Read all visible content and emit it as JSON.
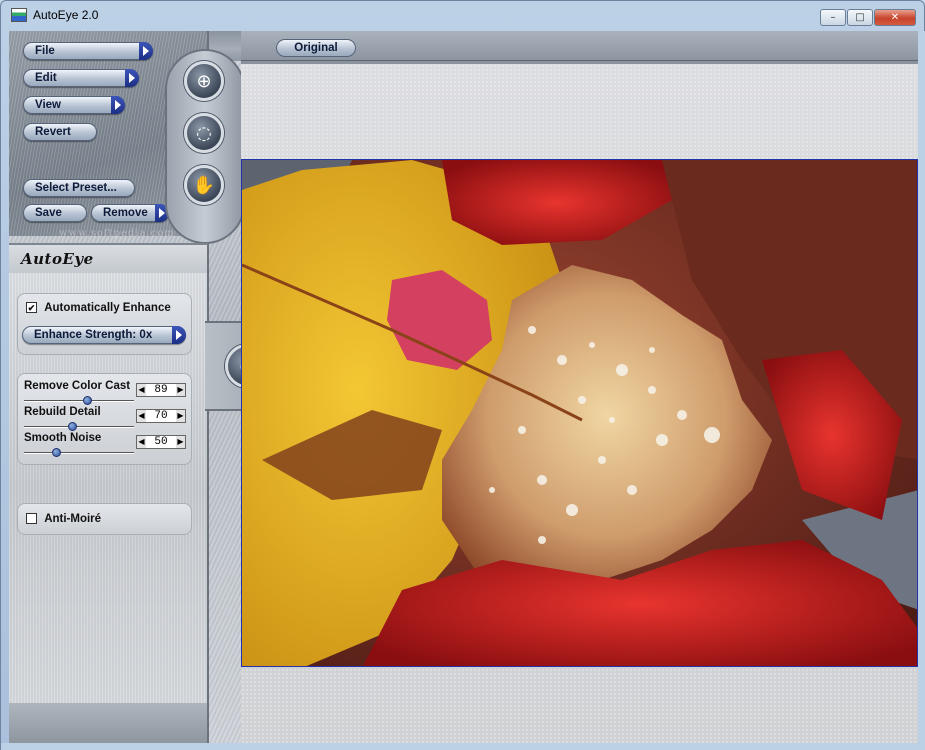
{
  "window": {
    "title": "AutoEye 2.0",
    "controls": {
      "minimize": "–",
      "maximize": "□",
      "close": "✕"
    }
  },
  "menu": {
    "file": "File",
    "edit": "Edit",
    "view": "View",
    "revert": "Revert",
    "select_preset": "Select Preset...",
    "save": "Save",
    "remove": "Remove"
  },
  "watermark": "www.softpedia.com",
  "tools": {
    "zoom_in": "zoom-in-icon",
    "navigator": "navigator-ring-icon",
    "hand": "hand-pan-icon"
  },
  "panel": {
    "title": "AutoEye",
    "tabs": [
      "eye-icon",
      "color-wheel-icon",
      "lightning-icon"
    ],
    "auto_enhance_label": "Automatically Enhance",
    "auto_enhance_checked": true,
    "enhance_strength": "Enhance Strength: 0x",
    "sliders": [
      {
        "label": "Remove Color Cast",
        "value": "89",
        "level": 0.89
      },
      {
        "label": "Rebuild Detail",
        "value": "70",
        "level": 0.7
      },
      {
        "label": "Smooth Noise",
        "value": "50",
        "level": 0.5
      }
    ],
    "anti_moire_label": "Anti-Moiré",
    "anti_moire_checked": false
  },
  "view": {
    "mode_button": "Original",
    "image_subject": "autumn leaves with water droplets"
  },
  "colors": {
    "accent_blue": "#1c2f86",
    "frame_gray": "#8a929d",
    "selection_border": "#2233aa"
  }
}
